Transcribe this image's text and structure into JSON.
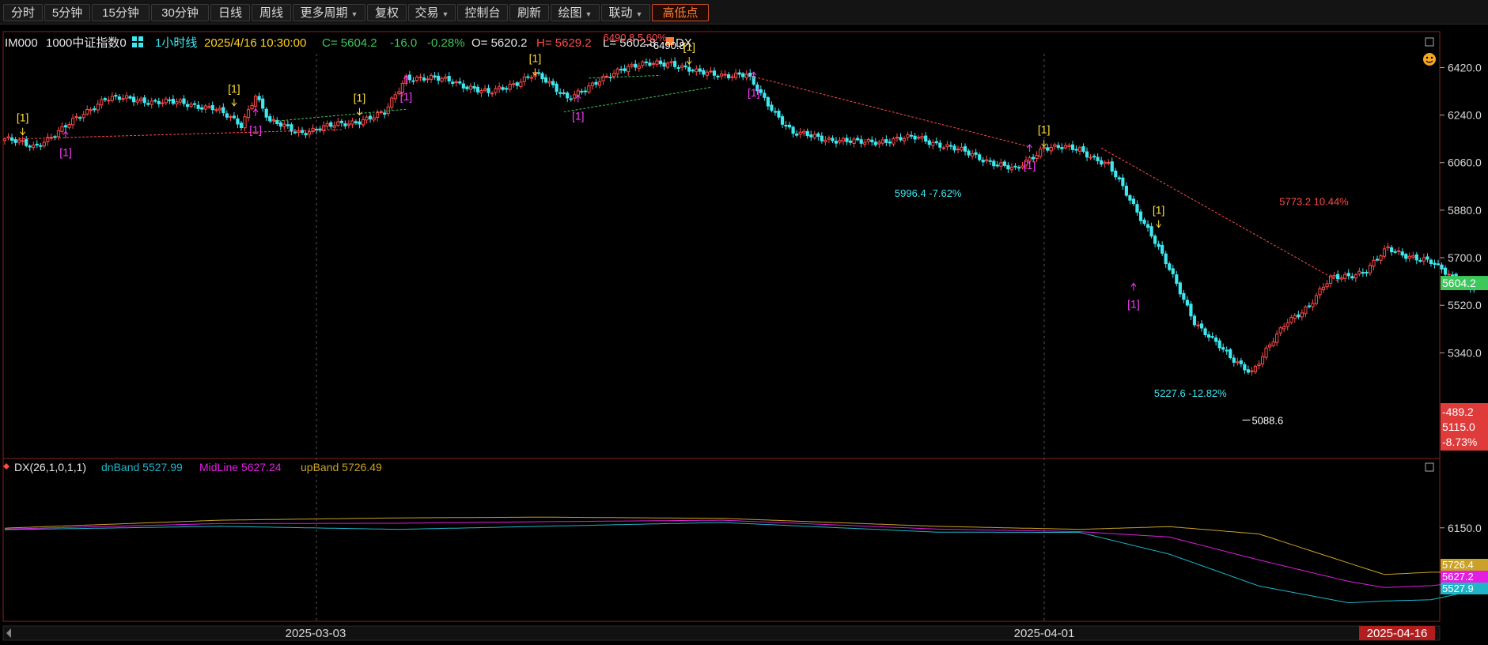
{
  "toolbar": {
    "items": [
      {
        "label": "分时",
        "dropdown": false
      },
      {
        "label": "5分钟",
        "dropdown": false
      },
      {
        "label": "15分钟",
        "dropdown": false
      },
      {
        "label": "30分钟",
        "dropdown": false
      },
      {
        "label": "日线",
        "dropdown": false
      },
      {
        "label": "周线",
        "dropdown": false
      },
      {
        "label": "更多周期",
        "dropdown": true
      },
      {
        "label": "复权",
        "dropdown": false
      },
      {
        "label": "交易",
        "dropdown": true
      },
      {
        "label": "控制台",
        "dropdown": false
      },
      {
        "label": "刷新",
        "dropdown": false
      },
      {
        "label": "绘图",
        "dropdown": true
      },
      {
        "label": "联动",
        "dropdown": true
      },
      {
        "label": "高低点",
        "dropdown": false,
        "active": true
      }
    ]
  },
  "header": {
    "code": "IM000",
    "name": "1000中证指数0",
    "period": "1小时线",
    "datetime": "2025/4/16 10:30:00",
    "close": "C= 5604.2",
    "change": "-16.0",
    "change_pct": "-0.28%",
    "open": "O= 5620.2",
    "high": "H= 5629.2",
    "low": "L= 5602.8",
    "indicator_tag": "DX"
  },
  "indicator_header": {
    "name": "DX(26,1,0,1,1)",
    "dn_label": "dnBand 5527.99",
    "mid_label": "MidLine 5627.24",
    "up_label": "upBand 5726.49"
  },
  "colors": {
    "up": "#ff4a4a",
    "down": "#3ee8f0",
    "signal_buy": "#ffe033",
    "signal_sell": "#ff3cff",
    "upband": "#c9a227",
    "midline": "#e11ee1",
    "dnband": "#1fb5c8",
    "last_price": "#3cc85a",
    "axis_red_bg": "#e03b3b",
    "accent": "#ff7a30"
  },
  "chart_data": {
    "type": "candlestick",
    "interval": "1小时线",
    "ylim": [
      5000,
      6520
    ],
    "y_ticks": [
      "6420.0",
      "6240.0",
      "6060.0",
      "5880.0",
      "5700.0",
      "5520.0",
      "5340.0"
    ],
    "x_ticks": [
      "2025-03-03",
      "2025-04-01"
    ],
    "last_date": "2025-04-16",
    "last_price": "5604.2",
    "axis_tags": [
      "-489.2",
      "5115.0",
      "-8.73%"
    ],
    "annotations": [
      {
        "text": "6490.8 5.60%",
        "value": 6490.8
      },
      {
        "text": "6490.8",
        "value": 6490.8
      },
      {
        "text": "5996.4 -7.62%",
        "value": 5996.4
      },
      {
        "text": "5227.6 -12.82%",
        "value": 5227.6
      },
      {
        "text": "5088.6",
        "value": 5088.6
      },
      {
        "text": "5773.2 10.44%",
        "value": 5773.2
      }
    ],
    "signal_label": "[1]",
    "anchors": [
      [
        0,
        6150
      ],
      [
        8,
        6120
      ],
      [
        16,
        6185
      ],
      [
        28,
        6305
      ],
      [
        45,
        6290
      ],
      [
        58,
        6270
      ],
      [
        66,
        6200
      ],
      [
        70,
        6320
      ],
      [
        74,
        6215
      ],
      [
        82,
        6175
      ],
      [
        96,
        6210
      ],
      [
        106,
        6245
      ],
      [
        112,
        6385
      ],
      [
        125,
        6370
      ],
      [
        135,
        6320
      ],
      [
        148,
        6395
      ],
      [
        157,
        6310
      ],
      [
        163,
        6340
      ],
      [
        172,
        6420
      ],
      [
        186,
        6440
      ],
      [
        193,
        6400
      ],
      [
        207,
        6390
      ],
      [
        212,
        6300
      ],
      [
        220,
        6170
      ],
      [
        238,
        6135
      ],
      [
        255,
        6155
      ],
      [
        270,
        6090
      ],
      [
        282,
        6030
      ],
      [
        290,
        6120
      ],
      [
        300,
        6110
      ],
      [
        308,
        6050
      ],
      [
        320,
        5790
      ],
      [
        332,
        5460
      ],
      [
        342,
        5320
      ],
      [
        348,
        5270
      ],
      [
        358,
        5460
      ],
      [
        364,
        5520
      ],
      [
        370,
        5620
      ],
      [
        380,
        5650
      ],
      [
        386,
        5735
      ],
      [
        398,
        5680
      ],
      [
        410,
        5580
      ]
    ],
    "series": [
      {
        "name": "upBand",
        "last": "5726.49",
        "anchors": [
          [
            0,
            6148
          ],
          [
            60,
            6200
          ],
          [
            110,
            6215
          ],
          [
            150,
            6220
          ],
          [
            200,
            6212
          ],
          [
            260,
            6160
          ],
          [
            300,
            6140
          ],
          [
            325,
            6158
          ],
          [
            350,
            6110
          ],
          [
            375,
            5920
          ],
          [
            385,
            5845
          ],
          [
            398,
            5860
          ],
          [
            410,
            5860
          ]
        ]
      },
      {
        "name": "MidLine",
        "last": "5627.24",
        "anchors": [
          [
            0,
            6142
          ],
          [
            60,
            6178
          ],
          [
            110,
            6180
          ],
          [
            150,
            6190
          ],
          [
            200,
            6200
          ],
          [
            260,
            6142
          ],
          [
            300,
            6125
          ],
          [
            325,
            6090
          ],
          [
            350,
            5940
          ],
          [
            375,
            5800
          ],
          [
            385,
            5760
          ],
          [
            398,
            5772
          ],
          [
            410,
            5800
          ]
        ]
      },
      {
        "name": "dnBand",
        "last": "5527.99",
        "anchors": [
          [
            0,
            6138
          ],
          [
            60,
            6160
          ],
          [
            110,
            6140
          ],
          [
            150,
            6160
          ],
          [
            200,
            6185
          ],
          [
            260,
            6122
          ],
          [
            300,
            6120
          ],
          [
            325,
            5978
          ],
          [
            350,
            5770
          ],
          [
            375,
            5660
          ],
          [
            385,
            5672
          ],
          [
            398,
            5680
          ],
          [
            410,
            5740
          ]
        ]
      }
    ],
    "indicator_ylim": [
      5560,
      6500
    ],
    "indicator_tick": "6150.0",
    "indicator_tags": [
      "5726.4",
      "5627.2",
      "5527.9"
    ]
  }
}
